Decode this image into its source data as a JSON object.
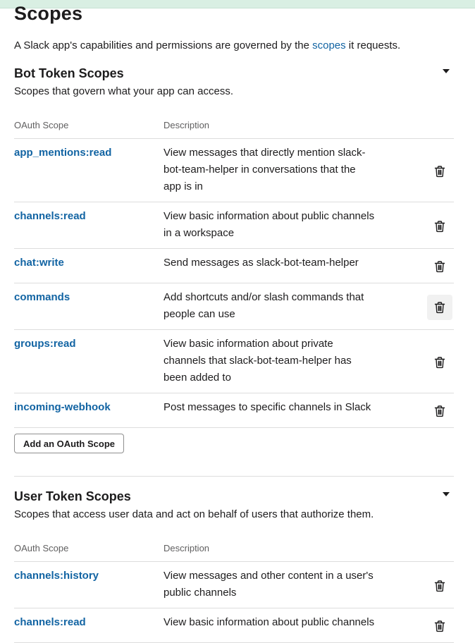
{
  "page": {
    "title": "Scopes",
    "intro_before": "A Slack app's capabilities and permissions are governed by the ",
    "intro_link": "scopes",
    "intro_after": " it requests."
  },
  "bot": {
    "title": "Bot Token Scopes",
    "subtitle": "Scopes that govern what your app can access.",
    "col_scope": "OAuth Scope",
    "col_desc": "Description",
    "rows": [
      {
        "scope": "app_mentions:read",
        "desc": [
          "View messages that directly mention slack-",
          "bot-team-helper in conversations that the",
          "app is in"
        ]
      },
      {
        "scope": "channels:read",
        "desc": [
          "View basic information about public channels",
          "in a workspace"
        ]
      },
      {
        "scope": "chat:write",
        "desc": [
          "Send messages as slack-bot-team-helper"
        ]
      },
      {
        "scope": "commands",
        "desc": [
          "Add shortcuts and/or slash commands that",
          "people can use"
        ]
      },
      {
        "scope": "groups:read",
        "desc": [
          "View basic information about private",
          "channels that slack-bot-team-helper has",
          "been added to"
        ]
      },
      {
        "scope": "incoming-webhook",
        "desc": [
          "Post messages to specific channels in Slack"
        ]
      }
    ],
    "add_button": "Add an OAuth Scope"
  },
  "user": {
    "title": "User Token Scopes",
    "subtitle": "Scopes that access user data and act on behalf of users that authorize them.",
    "col_scope": "OAuth Scope",
    "col_desc": "Description",
    "rows": [
      {
        "scope": "channels:history",
        "desc": [
          "View messages and other content in a user's",
          "public channels"
        ]
      },
      {
        "scope": "channels:read",
        "desc": [
          "View basic information about public channels"
        ]
      }
    ]
  }
}
